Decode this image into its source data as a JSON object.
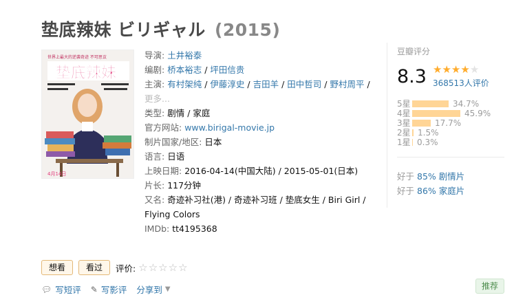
{
  "title": "垫底辣妹 ビリギャル",
  "year": "(2015)",
  "poster": {
    "top_text": "世界上最大的逆袭奇迹 不可思议",
    "title_text": "垫底辣妹",
    "date_text": "4月14日"
  },
  "info": {
    "director_label": "导演",
    "director": "土井裕泰",
    "writer_label": "编剧",
    "writers": [
      "桥本裕志",
      "坪田信贵"
    ],
    "cast_label": "主演",
    "cast": [
      "有村架纯",
      "伊藤淳史",
      "吉田羊",
      "田中哲司",
      "野村周平"
    ],
    "more": "更多...",
    "genre_label": "类型",
    "genres": [
      "剧情",
      "家庭"
    ],
    "website_label": "官方网站",
    "website": "www.birigal-movie.jp",
    "country_label": "制片国家/地区",
    "country": "日本",
    "language_label": "语言",
    "language": "日语",
    "release_label": "上映日期",
    "release_1": "2016-04-14(中国大陆)",
    "release_2": "2015-05-01(日本)",
    "runtime_label": "片长",
    "runtime": "117分钟",
    "aka_label": "又名",
    "aka": "奇迹补习社(港) / 奇迹补习班 / 垫底女生 / Biri Girl / Flying Colors",
    "imdb_label": "IMDb",
    "imdb": "tt4195368"
  },
  "rating": {
    "title": "豆瓣评分",
    "score": "8.3",
    "stars_filled": 4,
    "stars_total": 5,
    "votes": "368513人评价",
    "distribution": [
      {
        "label": "5星",
        "pct": "34.7%",
        "value": 34.7
      },
      {
        "label": "4星",
        "pct": "45.9%",
        "value": 45.9
      },
      {
        "label": "3星",
        "pct": "17.7%",
        "value": 17.7
      },
      {
        "label": "2星",
        "pct": "1.5%",
        "value": 1.5
      },
      {
        "label": "1星",
        "pct": "0.3%",
        "value": 0.3
      }
    ],
    "better_1_prefix": "好于",
    "better_1_pct": "85%",
    "better_1_genre": "剧情片",
    "better_2_prefix": "好于",
    "better_2_pct": "86%",
    "better_2_genre": "家庭片"
  },
  "actions": {
    "want": "想看",
    "seen": "看过",
    "rate_label": "评价:"
  },
  "links": {
    "short_review": "写短评",
    "review": "写影评",
    "share": "分享到"
  },
  "recommend": "推荐",
  "colors": {
    "link": "#3377aa",
    "star": "#ffac2d",
    "bar": "#ffd596",
    "button_bg": "#fff7ea",
    "recommend_green": "#4e8d4e"
  }
}
